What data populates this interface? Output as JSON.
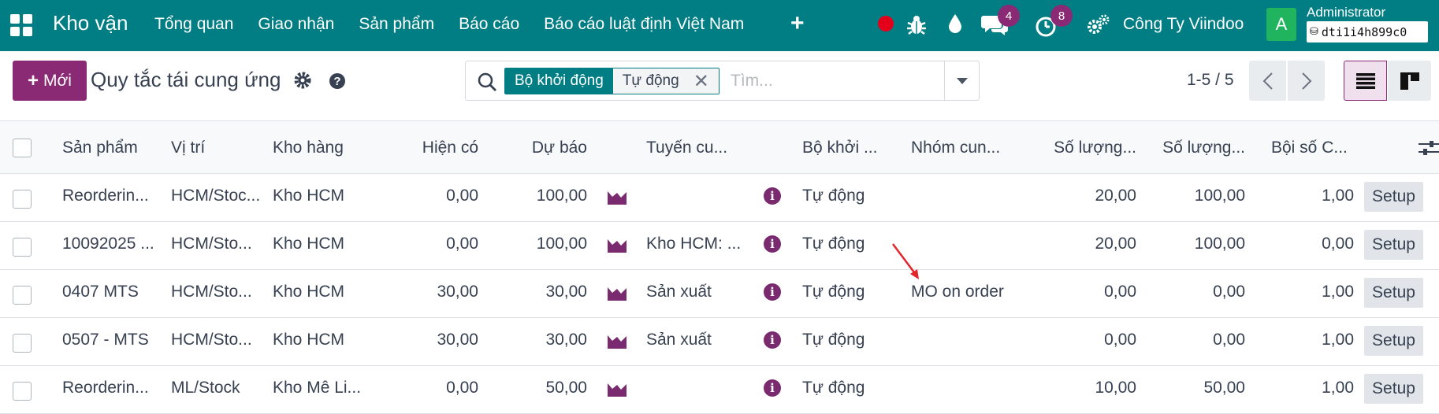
{
  "topnav": {
    "app_title": "Kho vận",
    "menu": [
      "Tổng quan",
      "Giao nhận",
      "Sản phẩm",
      "Báo cáo",
      "Báo cáo luật định Việt Nam"
    ],
    "add_icon": "plus-icon",
    "messages_count": "4",
    "activities_count": "8",
    "company": "Công Ty Viindoo",
    "avatar_letter": "A",
    "user_name": "Administrator",
    "db_name": "dti1i4h899c0",
    "colors": {
      "bar": "#017e84",
      "accent": "#8b2a74",
      "record": "#e3001a",
      "avatar": "#21b45e"
    }
  },
  "control": {
    "new_label": "Mới",
    "page_title": "Quy tắc tái cung ứng",
    "search": {
      "facet_label": "Bộ khởi động",
      "facet_value": "Tự động",
      "placeholder": "Tìm..."
    },
    "pager": "1-5 / 5"
  },
  "table": {
    "headers": [
      "Sản phẩm",
      "Vị trí",
      "Kho hàng",
      "Hiện có",
      "Dự báo",
      "Tuyến cu...",
      "Bộ khởi ...",
      "Nhóm cun...",
      "Số lượng...",
      "Số lượng...",
      "Bội số C..."
    ],
    "rows": [
      {
        "product": "Reorderin...",
        "location": "HCM/Stoc...",
        "warehouse": "Kho HCM",
        "on_hand": "0,00",
        "forecast": "100,00",
        "route": "",
        "trigger": "Tự động",
        "group": "",
        "min_qty": "20,00",
        "max_qty": "100,00",
        "multiple": "1,00",
        "action": "Setup"
      },
      {
        "product": "10092025 ...",
        "location": "HCM/Sto...",
        "warehouse": "Kho HCM",
        "on_hand": "0,00",
        "forecast": "100,00",
        "route": "Kho HCM: ...",
        "trigger": "Tự động",
        "group": "",
        "min_qty": "20,00",
        "max_qty": "100,00",
        "multiple": "0,00",
        "action": "Setup"
      },
      {
        "product": "0407 MTS",
        "location": "HCM/Sto...",
        "warehouse": "Kho HCM",
        "on_hand": "30,00",
        "forecast": "30,00",
        "route": "Sản xuất",
        "trigger": "Tự động",
        "group": "MO on order",
        "min_qty": "0,00",
        "max_qty": "0,00",
        "multiple": "1,00",
        "action": "Setup"
      },
      {
        "product": "0507 - MTS",
        "location": "HCM/Sto...",
        "warehouse": "Kho HCM",
        "on_hand": "30,00",
        "forecast": "30,00",
        "route": "Sản xuất",
        "trigger": "Tự động",
        "group": "",
        "min_qty": "0,00",
        "max_qty": "0,00",
        "multiple": "1,00",
        "action": "Setup"
      },
      {
        "product": "Reorderin...",
        "location": "ML/Stock",
        "warehouse": "Kho Mê Li...",
        "on_hand": "0,00",
        "forecast": "50,00",
        "route": "",
        "trigger": "Tự động",
        "group": "",
        "min_qty": "10,00",
        "max_qty": "50,00",
        "multiple": "1,00",
        "action": "Setup"
      }
    ]
  }
}
